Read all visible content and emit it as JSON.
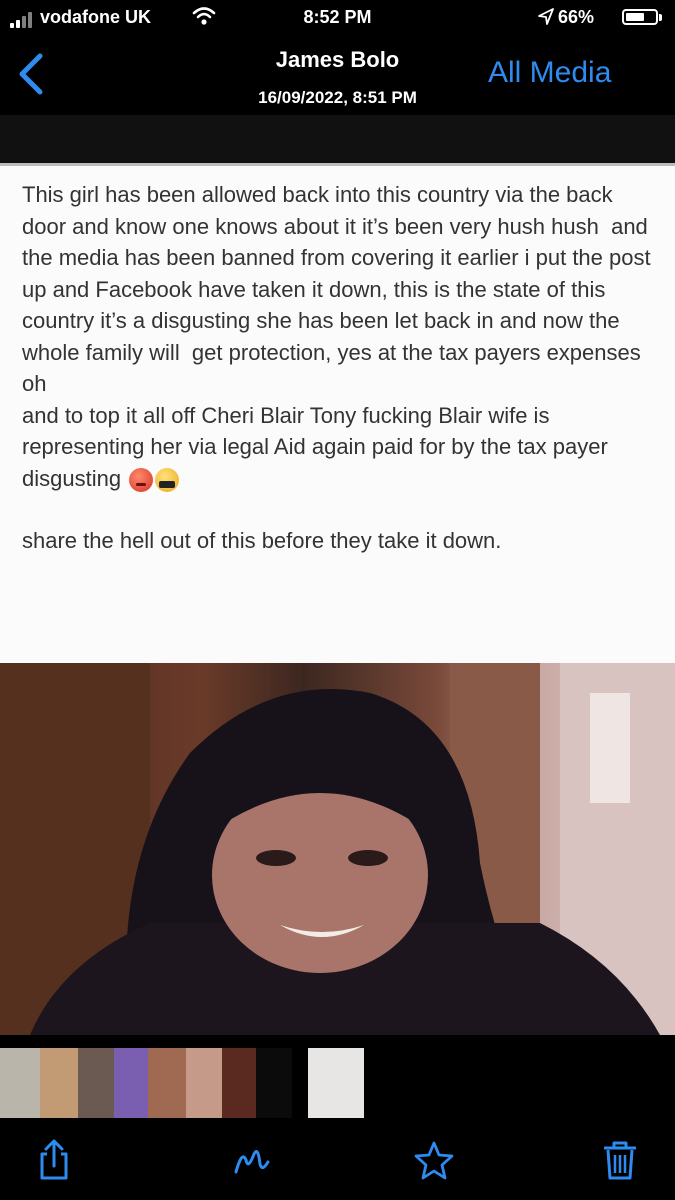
{
  "status_bar": {
    "carrier": "vodafone UK",
    "time": "8:52 PM",
    "battery_percent": "66%",
    "battery_level": 0.66,
    "icons": [
      "signal-icon",
      "wifi-icon",
      "location-arrow-icon",
      "battery-icon"
    ]
  },
  "nav": {
    "back_icon": "chevron-left-icon",
    "title": "James Bolo",
    "subtitle": "16/09/2022, 8:51 PM",
    "all_media": "All Media",
    "accent_color": "#2e8bf0"
  },
  "post": {
    "paragraph_1": "This girl has been allowed back into this country via the back door and know one knows about it it’s been very hush hush  and the media has been banned from covering it earlier i put the post up and Facebook have taken it down, this is the state of this country it’s a disgusting she has been let back in and now the whole family will  get protection, yes at the tax payers expenses",
    "line_oh": "oh",
    "paragraph_2": "and to top it all off Cheri Blair Tony fucking Blair wife is representing her via legal Aid again paid for by the tax payer disgusting",
    "emojis": [
      "angry-face-icon",
      "cursing-face-icon"
    ],
    "paragraph_3": "share the hell out of this before they take it down."
  },
  "toolbar": {
    "icons": [
      "share-icon",
      "markup-icon",
      "favorite-star-icon",
      "trash-icon"
    ]
  }
}
